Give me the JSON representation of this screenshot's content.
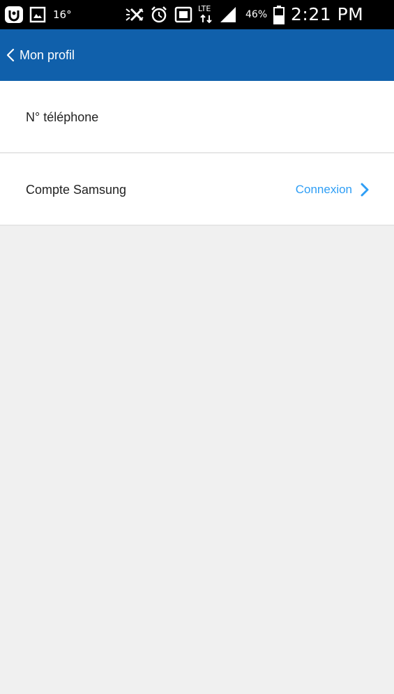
{
  "status_bar": {
    "temperature": "16°",
    "battery_percent": "46%",
    "network": "LTE",
    "time": "2:21 PM",
    "icons": [
      "app-notification-icon",
      "gallery-icon",
      "mute-icon",
      "alarm-icon",
      "nfc-icon",
      "lte-icon",
      "signal-icon",
      "battery-icon"
    ]
  },
  "app_bar": {
    "back_label": "Mon profil",
    "color": "#1060ab"
  },
  "settings": {
    "items": [
      {
        "label": "N° téléphone"
      },
      {
        "label": "Compte Samsung",
        "action": "Connexion"
      }
    ],
    "action_color": "#2e9ef5"
  }
}
